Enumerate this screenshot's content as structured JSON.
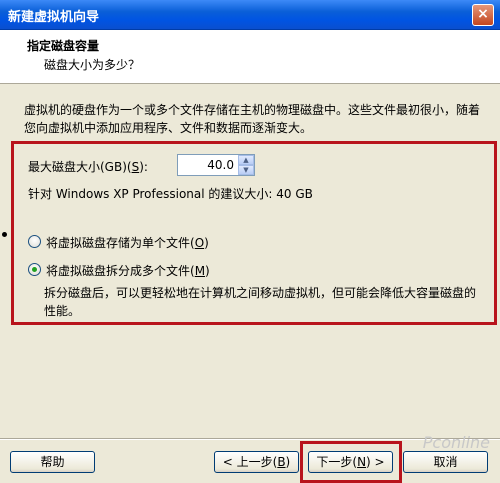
{
  "window": {
    "title": "新建虚拟机向导",
    "close_glyph": "×"
  },
  "header": {
    "title": "指定磁盘容量",
    "subtitle": "磁盘大小为多少？"
  },
  "description": "虚拟机的硬盘作为一个或多个文件存储在主机的物理磁盘中。这些文件最初很小，随着您向虚拟机中添加应用程序、文件和数据而逐渐变大。",
  "disk": {
    "max_size_label_pre": "最大磁盘大小(GB)(",
    "max_size_label_key": "S",
    "max_size_label_post": "):",
    "max_size_value": "40.0",
    "recommendation": "针对 Windows XP Professional 的建议大小: 40 GB"
  },
  "options": {
    "single": {
      "label_pre": "将虚拟磁盘存储为单个文件(",
      "label_key": "O",
      "label_post": ")",
      "checked": false
    },
    "split": {
      "label_pre": "将虚拟磁盘拆分成多个文件(",
      "label_key": "M",
      "label_post": ")",
      "checked": true,
      "description": "拆分磁盘后，可以更轻松地在计算机之间移动虚拟机，但可能会降低大容量磁盘的性能。"
    }
  },
  "buttons": {
    "help": "帮助",
    "back_pre": "< 上一步(",
    "back_key": "B",
    "back_post": ")",
    "next_pre": "下一步(",
    "next_key": "N",
    "next_post": ") >",
    "cancel": "取消"
  },
  "watermark": "Pconline",
  "colors": {
    "highlight_frame": "#b8141c",
    "titlebar": "#0054e3",
    "dialog_bg": "#ece9d8"
  }
}
